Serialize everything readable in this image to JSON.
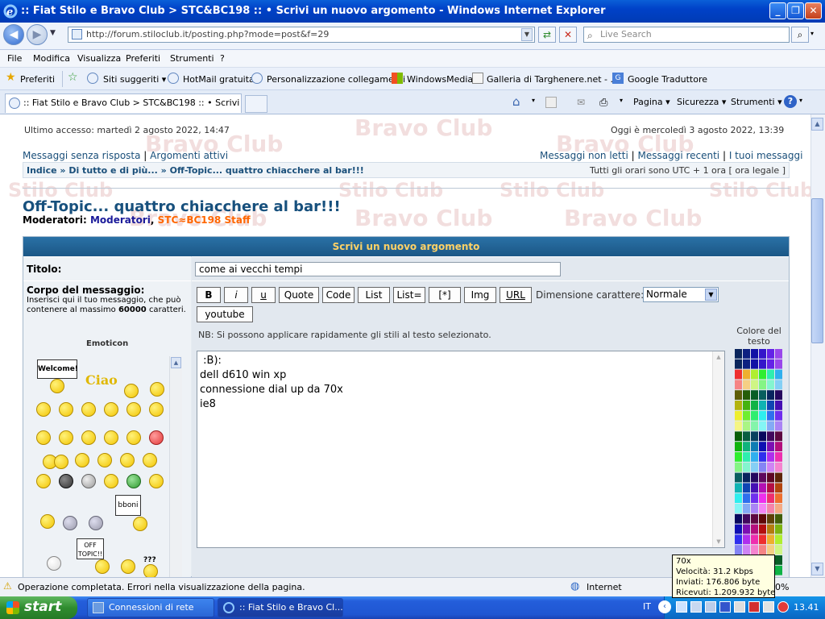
{
  "window": {
    "title": ":: Fiat Stilo e Bravo Club > STC&BC198 :: • Scrivi un nuovo argomento - Windows Internet Explorer"
  },
  "toolbar": {
    "url": "http://forum.stiloclub.it/posting.php?mode=post&f=29",
    "search_placeholder": "Live Search"
  },
  "menu": [
    "File",
    "Modifica",
    "Visualizza",
    "Preferiti",
    "Strumenti",
    "?"
  ],
  "favorites": {
    "label": "Preferiti",
    "items": [
      "Siti suggeriti ▾",
      "HotMail gratuita",
      "Personalizzazione collegamenti",
      "WindowsMedia",
      "Galleria di Targhenere.net - ...",
      "Google Traduttore"
    ]
  },
  "tab": {
    "label": ":: Fiat Stilo e Bravo Club > STC&BC198 :: • Scrivi un n..."
  },
  "commands": {
    "pagina": "Pagina ▾",
    "sicurezza": "Sicurezza ▾",
    "strumenti": "Strumenti ▾"
  },
  "watermark": [
    "Stilo Club",
    "Bravo Club"
  ],
  "page": {
    "last_access": "Ultimo accesso: martedì 2 agosto 2022, 14:47",
    "today": "Oggi è mercoledì 3 agosto 2022, 13:39",
    "links_left": [
      "Messaggi senza risposta",
      "Argomenti attivi"
    ],
    "links_right": [
      "Messaggi non letti",
      "Messaggi recenti",
      "I tuoi messaggi"
    ],
    "breadcrumb": [
      "Indice",
      "Di tutto e di più...",
      "Off-Topic... quattro chiacchere al bar!!!"
    ],
    "timezone": "Tutti gli orari sono UTC + 1 ora [ ora legale ]",
    "forum_title": "Off-Topic... quattro chiacchere al bar!!!",
    "moderators_label": "Moderatori:",
    "moderators": [
      "Moderatori",
      "STC≈BC198 Staff"
    ],
    "form_header": "Scrivi un nuovo argomento",
    "title_label": "Titolo:",
    "title_value": "come ai vecchi tempi",
    "body_label": "Corpo del messaggio:",
    "body_hint_prefix": "Inserisci qui il tuo messaggio, che può contenere al massimo",
    "body_hint_max": "60000",
    "body_hint_suffix": "caratteri.",
    "emoticon_label": "Emoticon",
    "bbcode_buttons": [
      "B",
      "i",
      "u",
      "Quote",
      "Code",
      "List",
      "List=",
      "[*]",
      "Img",
      "URL"
    ],
    "youtube_button": "youtube",
    "font_size_label": "Dimensione carattere:",
    "font_size_value": "Normale",
    "hint": "NB: Si possono applicare rapidamente gli stili al testo selezionato.",
    "color_label": "Colore del testo",
    "message": " :B):\ndell d610 win xp\nconnessione dial up da 70x\nie8",
    "emoticon_signs": [
      "Welcome!",
      "Ciao",
      "bboni",
      "OFF TOPIC!!",
      "???"
    ]
  },
  "status": {
    "text": "Operazione completata. Errori nella visualizzazione della pagina.",
    "zone": "Internet",
    "zoom": "0%"
  },
  "tooltip": {
    "lines": [
      "70x",
      "Velocità: 31.2 Kbps",
      "Inviati: 176.806 byte",
      "Ricevuti: 1.209.932 byte"
    ]
  },
  "taskbar": {
    "start": "start",
    "buttons": [
      "Connessioni di rete",
      ":: Fiat Stilo e Bravo Cl..."
    ],
    "lang": "IT",
    "clock": "13.41"
  },
  "colors": {
    "title_blue": "#0041c8",
    "forum_title": "#17507d",
    "header_blue": "#1b5786",
    "header_text": "#ffd266",
    "moderator_orange": "#ff6600"
  }
}
